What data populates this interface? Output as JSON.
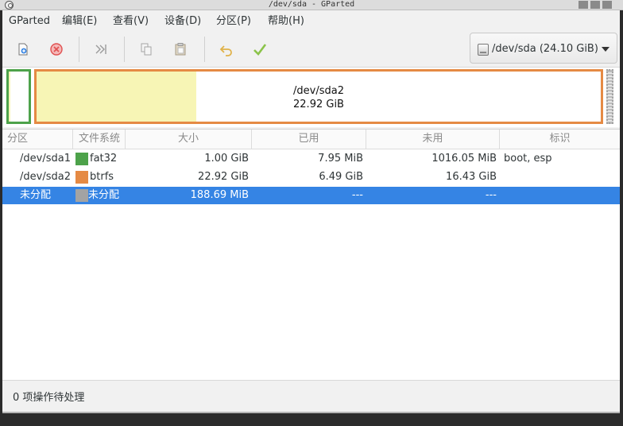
{
  "window": {
    "title": "/dev/sda - GParted"
  },
  "menu": {
    "items": [
      "GParted",
      "编辑(E)",
      "查看(V)",
      "设备(D)",
      "分区(P)",
      "帮助(H)"
    ]
  },
  "toolbar": {
    "icons": [
      "new-partition-icon",
      "delete-icon",
      "resize-move-icon",
      "copy-icon",
      "paste-icon",
      "undo-icon",
      "apply-icon"
    ]
  },
  "device": {
    "label": "/dev/sda (24.10 GiB)"
  },
  "partition_map": {
    "sda2_name": "/dev/sda2",
    "sda2_size": "22.92 GiB",
    "sda2_used_fraction": 0.283,
    "colors": {
      "fat32": "#4da24a",
      "btrfs": "#e58a44",
      "used": "#f7f5b5",
      "unallocated": "#a3a3a3"
    }
  },
  "table": {
    "headers": [
      "分区",
      "文件系统",
      "大小",
      "已用",
      "未用",
      "标识"
    ],
    "rows": [
      {
        "partition": "/dev/sda1",
        "filesystem": "fat32",
        "size": "1.00 GiB",
        "used": "7.95 MiB",
        "unused": "1016.05 MiB",
        "flags": "boot, esp",
        "color": "#4da24a",
        "selected": false
      },
      {
        "partition": "/dev/sda2",
        "filesystem": "btrfs",
        "size": "22.92 GiB",
        "used": "6.49 GiB",
        "unused": "16.43 GiB",
        "flags": "",
        "color": "#e58a44",
        "selected": false
      },
      {
        "partition": "未分配",
        "filesystem": "未分配",
        "size": "188.69 MiB",
        "used": "---",
        "unused": "---",
        "flags": "",
        "color": "#a3a3a3",
        "selected": true
      }
    ]
  },
  "status": {
    "text": "0 项操作待处理"
  }
}
